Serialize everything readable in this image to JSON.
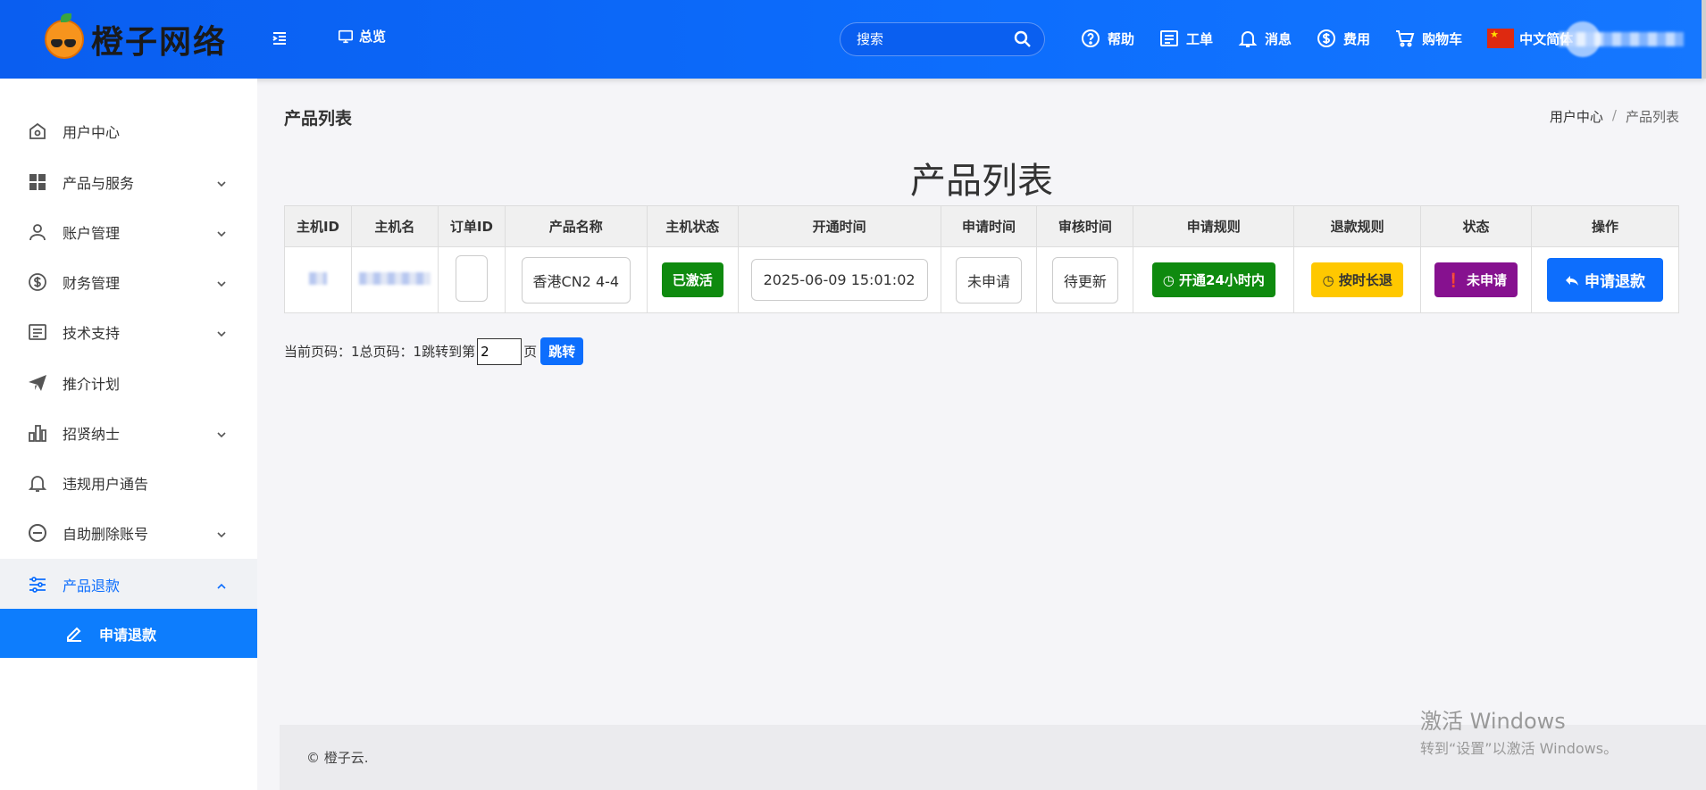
{
  "header": {
    "logo_text": "橙子网络",
    "overview_label": "总览",
    "search_placeholder": "搜索",
    "nav": [
      {
        "label": "帮助",
        "icon": "help-icon"
      },
      {
        "label": "工单",
        "icon": "ticket-icon"
      },
      {
        "label": "消息",
        "icon": "bell-icon"
      },
      {
        "label": "费用",
        "icon": "dollar-icon"
      },
      {
        "label": "购物车",
        "icon": "cart-icon"
      }
    ],
    "language": "中文简体"
  },
  "sidebar": {
    "items": [
      {
        "label": "用户中心",
        "icon": "home-icon"
      },
      {
        "label": "产品与服务",
        "icon": "grid-icon"
      },
      {
        "label": "账户管理",
        "icon": "user-icon"
      },
      {
        "label": "财务管理",
        "icon": "dollar-circle-icon"
      },
      {
        "label": "技术支持",
        "icon": "document-icon"
      },
      {
        "label": "推介计划",
        "icon": "send-icon"
      },
      {
        "label": "招贤纳士",
        "icon": "bar-chart-icon"
      },
      {
        "label": "违规用户通告",
        "icon": "bell-icon"
      },
      {
        "label": "自助删除账号",
        "icon": "minus-circle-icon"
      },
      {
        "label": "产品退款",
        "icon": "sliders-icon"
      }
    ],
    "sub_item": {
      "label": "申请退款",
      "icon": "pen-icon"
    }
  },
  "content": {
    "page_title": "产品列表",
    "breadcrumb": {
      "home": "用户中心",
      "separator": "/",
      "current": "产品列表"
    },
    "big_title": "产品列表",
    "table": {
      "headers": [
        "主机ID",
        "主机名",
        "订单ID",
        "产品名称",
        "主机状态",
        "开通时间",
        "申请时间",
        "审核时间",
        "申请规则",
        "退款规则",
        "状态",
        "操作"
      ],
      "row": {
        "product_name": "香港CN2 4-4",
        "host_status": "已激活",
        "open_time": "2025-06-09 15:01:02",
        "apply_time": "未申请",
        "review_time": "待更新",
        "apply_rule": "开通24小时内",
        "refund_rule": "按时长退",
        "status": "未申请",
        "action": "申请退款"
      }
    },
    "pager": {
      "current_label": "当前页码：1",
      "total_label": "总页码：1",
      "jump_label": "跳转到第",
      "input_value": "2",
      "page_suffix": "页",
      "jump_button": "跳转"
    }
  },
  "footer": {
    "copyright": "© 橙子云."
  },
  "watermark": {
    "line1": "激活 Windows",
    "line2": "转到“设置”以激活 Windows。"
  }
}
